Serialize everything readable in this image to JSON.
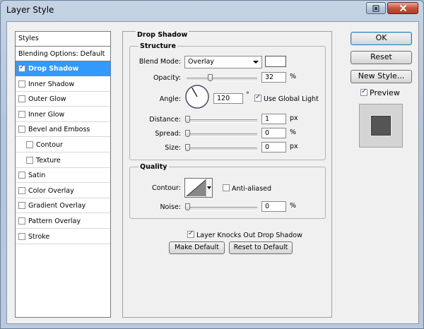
{
  "window": {
    "title": "Layer Style"
  },
  "styles_list": {
    "header": "Styles",
    "blending_options": "Blending Options: Default",
    "items": [
      {
        "label": "Drop Shadow",
        "checked": true,
        "selected": true
      },
      {
        "label": "Inner Shadow",
        "checked": false
      },
      {
        "label": "Outer Glow",
        "checked": false
      },
      {
        "label": "Inner Glow",
        "checked": false
      },
      {
        "label": "Bevel and Emboss",
        "checked": false
      },
      {
        "label": "Contour",
        "checked": false,
        "sub": true
      },
      {
        "label": "Texture",
        "checked": false,
        "sub": true
      },
      {
        "label": "Satin",
        "checked": false
      },
      {
        "label": "Color Overlay",
        "checked": false
      },
      {
        "label": "Gradient Overlay",
        "checked": false
      },
      {
        "label": "Pattern Overlay",
        "checked": false
      },
      {
        "label": "Stroke",
        "checked": false
      }
    ]
  },
  "drop_shadow": {
    "section_title": "Drop Shadow",
    "structure": {
      "title": "Structure",
      "blend_mode_label": "Blend Mode:",
      "blend_mode_value": "Overlay",
      "shadow_color": "#ffffff",
      "opacity_label": "Opacity:",
      "opacity_value": "32",
      "opacity_unit": "%",
      "opacity_fraction": 0.32,
      "angle_label": "Angle:",
      "angle_value": "120",
      "angle_unit": "°",
      "use_global_light_label": "Use Global Light",
      "use_global_light": true,
      "distance_label": "Distance:",
      "distance_value": "1",
      "distance_unit": "px",
      "spread_label": "Spread:",
      "spread_value": "0",
      "spread_unit": "%",
      "size_label": "Size:",
      "size_value": "0",
      "size_unit": "px"
    },
    "quality": {
      "title": "Quality",
      "contour_label": "Contour:",
      "anti_aliased_label": "Anti-aliased",
      "anti_aliased": false,
      "noise_label": "Noise:",
      "noise_value": "0",
      "noise_unit": "%"
    },
    "knockout_label": "Layer Knocks Out Drop Shadow",
    "knockout": true,
    "make_default_label": "Make Default",
    "reset_default_label": "Reset to Default"
  },
  "buttons": {
    "ok": "OK",
    "reset": "Reset",
    "new_style": "New Style...",
    "preview_label": "Preview",
    "preview_checked": true
  },
  "colors": {
    "selection": "#3399ff",
    "preview_fill": "#555555"
  }
}
